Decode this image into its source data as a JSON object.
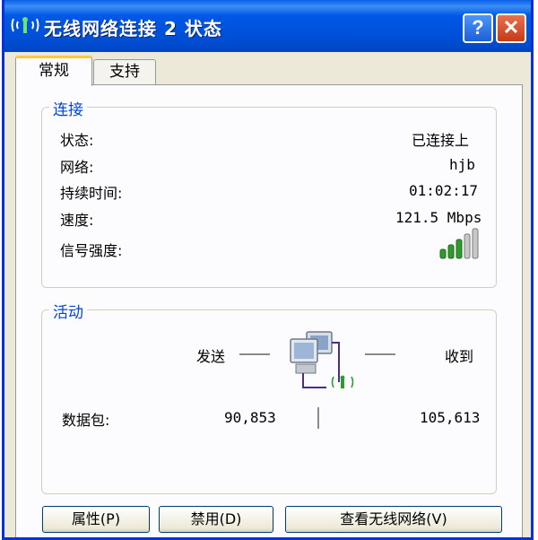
{
  "window": {
    "title": "无线网络连接 2 状态",
    "help_label": "?",
    "close_label": "✕"
  },
  "tabs": [
    {
      "label": "常规",
      "active": true
    },
    {
      "label": "支持",
      "active": false
    }
  ],
  "connection": {
    "group_title": "连接",
    "status_label": "状态:",
    "status_value": "已连接上",
    "network_label": "网络:",
    "network_value": "hjb",
    "duration_label": "持续时间:",
    "duration_value": "01:02:17",
    "speed_label": "速度:",
    "speed_value": "121.5 Mbps",
    "signal_label": "信号强度:",
    "signal_bars_filled": 3,
    "signal_bars_total": 5
  },
  "activity": {
    "group_title": "活动",
    "sent_label": "发送",
    "received_label": "收到",
    "packets_label": "数据包:",
    "packets_sent": "90,853",
    "packets_received": "105,613"
  },
  "buttons": {
    "properties": "属性(P)",
    "disable": "禁用(D)",
    "view_wireless": "查看无线网络(V)"
  },
  "colors": {
    "title_bar": "#0054e3",
    "group_title": "#0046d5",
    "signal_on": "#2f9b2f",
    "signal_off": "#c8c8c8"
  }
}
